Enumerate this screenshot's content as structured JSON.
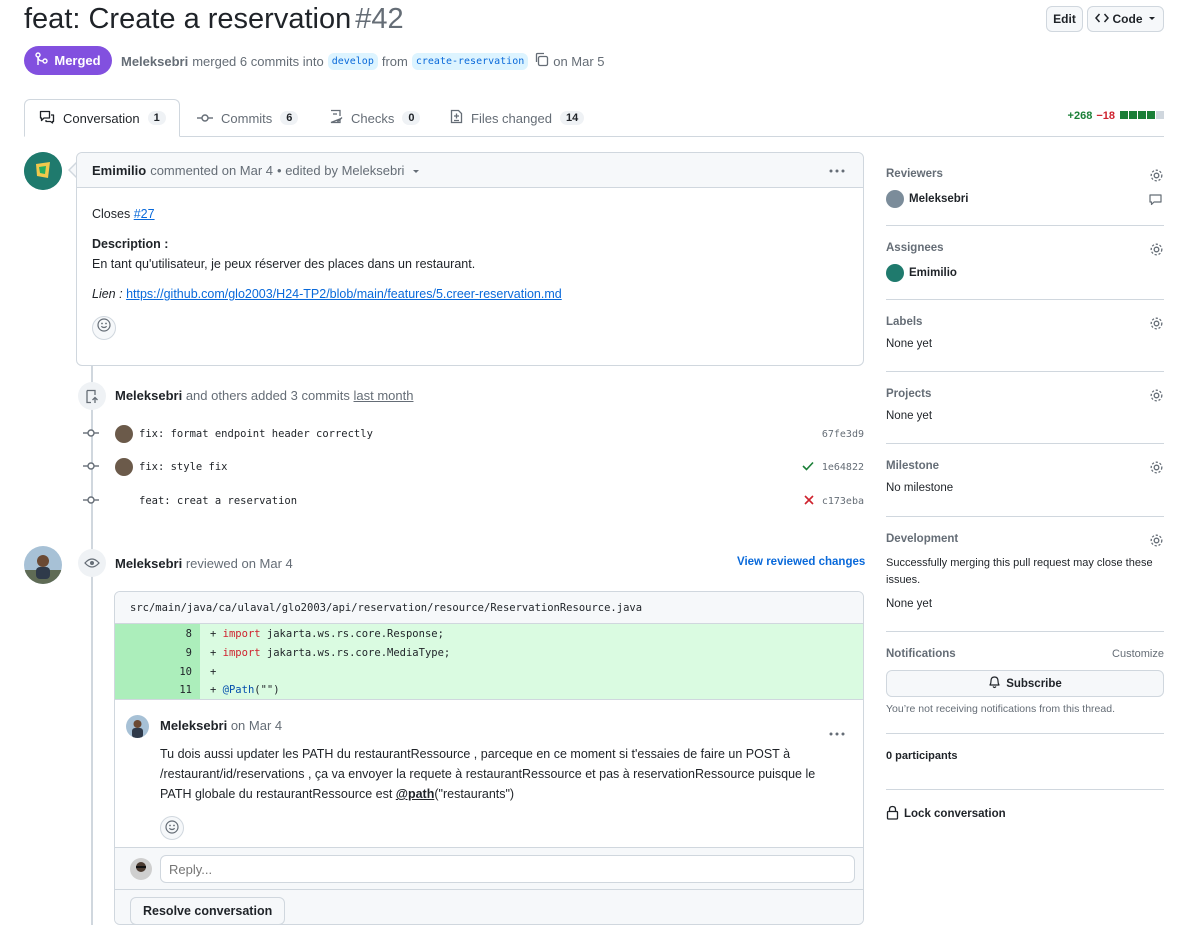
{
  "header": {
    "title": "feat: Create a reservation",
    "number": "#42",
    "edit_label": "Edit",
    "code_label": "Code",
    "status": "Merged",
    "author": "Meleksebri",
    "merge_text": "merged 6 commits into",
    "base_branch": "develop",
    "from_text": "from",
    "head_branch": "create-reservation",
    "date_text": "on Mar 5"
  },
  "tabs": [
    {
      "label": "Conversation",
      "count": "1"
    },
    {
      "label": "Commits",
      "count": "6"
    },
    {
      "label": "Checks",
      "count": "0"
    },
    {
      "label": "Files changed",
      "count": "14"
    }
  ],
  "diffstat": {
    "additions": "+268",
    "deletions": "−18"
  },
  "comment": {
    "author": "Emimilio",
    "action": "commented on Mar 4",
    "edited": "• edited by Meleksebri",
    "closes_label": "Closes",
    "closes_link": "#27",
    "desc_title": "Description :",
    "desc_text": "En tant qu'utilisateur, je peux réserver des places dans un restaurant.",
    "link_label": "Lien :",
    "link_url": "https://github.com/glo2003/H24-TP2/blob/main/features/5.creer-reservation.md"
  },
  "commits_event": {
    "author": "Meleksebri",
    "text": "and others added 3 commits",
    "when": "last month",
    "commits": [
      {
        "message": "fix: format endpoint header correctly",
        "sha": "67fe3d9",
        "status": ""
      },
      {
        "message": "fix: style fix",
        "sha": "1e64822",
        "status": "success"
      },
      {
        "message": "feat: creat a reservation",
        "sha": "c173eba",
        "status": "failure"
      }
    ]
  },
  "review": {
    "author": "Meleksebri",
    "action": "reviewed on Mar 4",
    "view_changes": "View reviewed changes",
    "file_path": "src/main/java/ca/ulaval/glo2003/api/reservation/resource/ReservationResource.java",
    "diff": [
      {
        "ln": "8",
        "prefix": "+ ",
        "kw": "import",
        "rest": " jakarta.ws.rs.core.Response;"
      },
      {
        "ln": "9",
        "prefix": "+ ",
        "kw": "import",
        "rest": " jakarta.ws.rs.core.MediaType;"
      },
      {
        "ln": "10",
        "prefix": "+",
        "kw": "",
        "rest": ""
      },
      {
        "ln": "11",
        "prefix": "+ ",
        "ann": "@Path",
        "rest": "(\"\")"
      }
    ],
    "reply_author": "Meleksebri",
    "reply_date": "on Mar 4",
    "reply_text_1": "Tu dois aussi updater les PATH du restaurantRessource , parceque en ce moment si t'essaies de faire un POST à",
    "reply_text_2": "/restaurant/id/reservations , ça va envoyer la requete à restaurantRessource et pas à reservationRessource puisque le",
    "reply_text_3a": "PATH globale du restaurantRessource est",
    "reply_mention": "@path",
    "reply_text_3b": "(\"restaurants\")",
    "reply_placeholder": "Reply...",
    "resolve_label": "Resolve conversation"
  },
  "sidebar": {
    "reviewers_label": "Reviewers",
    "reviewer": "Meleksebri",
    "assignees_label": "Assignees",
    "assignee": "Emimilio",
    "labels_label": "Labels",
    "labels_value": "None yet",
    "projects_label": "Projects",
    "projects_value": "None yet",
    "milestone_label": "Milestone",
    "milestone_value": "No milestone",
    "development_label": "Development",
    "development_text": "Successfully merging this pull request may close these issues.",
    "development_value": "None yet",
    "notifications_label": "Notifications",
    "customize_label": "Customize",
    "subscribe_label": "Subscribe",
    "notifications_text": "You’re not receiving notifications from this thread.",
    "participants": "0 participants",
    "lock_label": "Lock conversation"
  },
  "colors": {
    "merged": "#8250df",
    "link": "#0969da",
    "success": "#1a7f37",
    "danger": "#cf222e"
  }
}
